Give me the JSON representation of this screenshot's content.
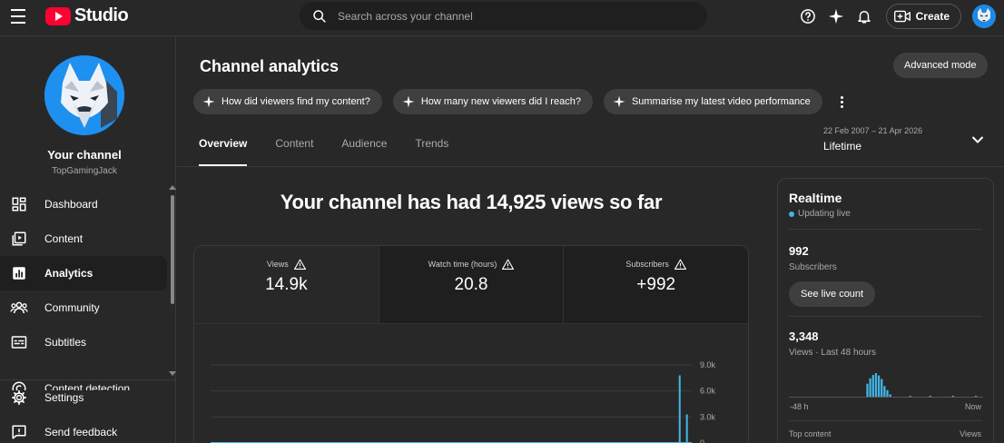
{
  "brand": {
    "name": "Studio"
  },
  "search": {
    "placeholder": "Search across your channel"
  },
  "topbar": {
    "create_label": "Create"
  },
  "sidebar": {
    "channel_name": "Your channel",
    "channel_handle": "TopGamingJack",
    "items": [
      {
        "label": "Dashboard",
        "icon": "dashboard-icon"
      },
      {
        "label": "Content",
        "icon": "content-icon"
      },
      {
        "label": "Analytics",
        "icon": "analytics-icon",
        "active": true
      },
      {
        "label": "Community",
        "icon": "community-icon"
      },
      {
        "label": "Subtitles",
        "icon": "subtitles-icon"
      },
      {
        "label": "Content detection",
        "icon": "content-detection-icon"
      }
    ],
    "bottom_items": [
      {
        "label": "Settings",
        "icon": "gear-icon"
      },
      {
        "label": "Send feedback",
        "icon": "feedback-icon"
      }
    ]
  },
  "main": {
    "title": "Channel analytics",
    "advanced_mode_label": "Advanced mode",
    "chips": [
      "How did viewers find my content?",
      "How many new viewers did I reach?",
      "Summarise my latest video performance"
    ],
    "tabs": [
      "Overview",
      "Content",
      "Audience",
      "Trends"
    ],
    "active_tab": "Overview",
    "date_range": {
      "range": "22 Feb 2007 – 21 Apr 2026",
      "label": "Lifetime"
    },
    "headline": "Your channel has had 14,925 views so far",
    "kpis": [
      {
        "label": "Views",
        "value": "14.9k"
      },
      {
        "label": "Watch time (hours)",
        "value": "20.8"
      },
      {
        "label": "Subscribers",
        "value": "+992"
      }
    ],
    "chart": {
      "y_ticks": [
        "9.0k",
        "6.0k",
        "3.0k",
        "0"
      ],
      "y_tick_values": [
        9000,
        6000,
        3000,
        0
      ],
      "ylim": [
        0,
        9000
      ],
      "spikes": [
        {
          "position": 0.975,
          "value": 7800
        },
        {
          "position": 0.99,
          "value": 3300
        }
      ],
      "line_color": "#41b7e6"
    }
  },
  "realtime": {
    "title": "Realtime",
    "status": "Updating live",
    "subscribers_value": "992",
    "subscribers_label": "Subscribers",
    "see_live_label": "See live count",
    "views_value": "3,348",
    "views_label": "Views · Last 48 hours",
    "axis_start": "-48 h",
    "axis_end": "Now",
    "top_content_label": "Top content",
    "top_content_metric": "Views",
    "bars": [
      0,
      0,
      0,
      0,
      0,
      0,
      0,
      0,
      0,
      0,
      0,
      0,
      0,
      0,
      0,
      0,
      0,
      0,
      0,
      0,
      0,
      0,
      0,
      0,
      0,
      0,
      0,
      0.55,
      0.78,
      0.92,
      1.0,
      0.9,
      0.75,
      0.45,
      0.28,
      0.1,
      0,
      0,
      0,
      0,
      0,
      0,
      0.04,
      0,
      0,
      0,
      0,
      0,
      0,
      0.04,
      0,
      0,
      0,
      0,
      0,
      0,
      0,
      0.04,
      0,
      0,
      0,
      0,
      0,
      0,
      0,
      0.04,
      0,
      0
    ],
    "bar_color": "#41b7e6"
  },
  "colors": {
    "accent": "#41b7e6",
    "brand_red": "#ff0033",
    "background": "#282828"
  }
}
